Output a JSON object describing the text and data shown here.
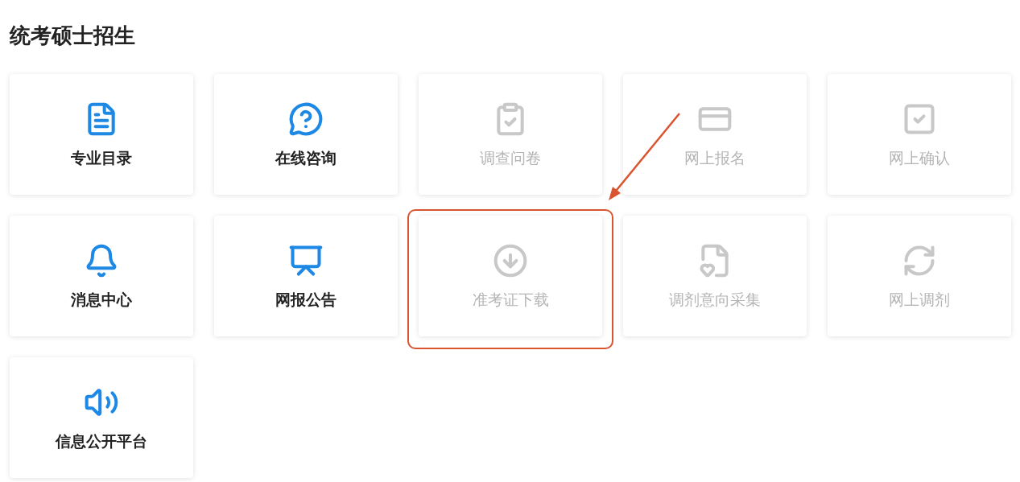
{
  "section_title": "统考硕士招生",
  "items": [
    {
      "label": "专业目录",
      "disabled": false,
      "highlighted": false
    },
    {
      "label": "在线咨询",
      "disabled": false,
      "highlighted": false
    },
    {
      "label": "调查问卷",
      "disabled": true,
      "highlighted": false
    },
    {
      "label": "网上报名",
      "disabled": true,
      "highlighted": false
    },
    {
      "label": "网上确认",
      "disabled": true,
      "highlighted": false
    },
    {
      "label": "消息中心",
      "disabled": false,
      "highlighted": false
    },
    {
      "label": "网报公告",
      "disabled": false,
      "highlighted": false
    },
    {
      "label": "准考证下载",
      "disabled": true,
      "highlighted": true
    },
    {
      "label": "调剂意向采集",
      "disabled": true,
      "highlighted": false
    },
    {
      "label": "网上调剂",
      "disabled": true,
      "highlighted": false
    },
    {
      "label": "信息公开平台",
      "disabled": false,
      "highlighted": false
    }
  ]
}
